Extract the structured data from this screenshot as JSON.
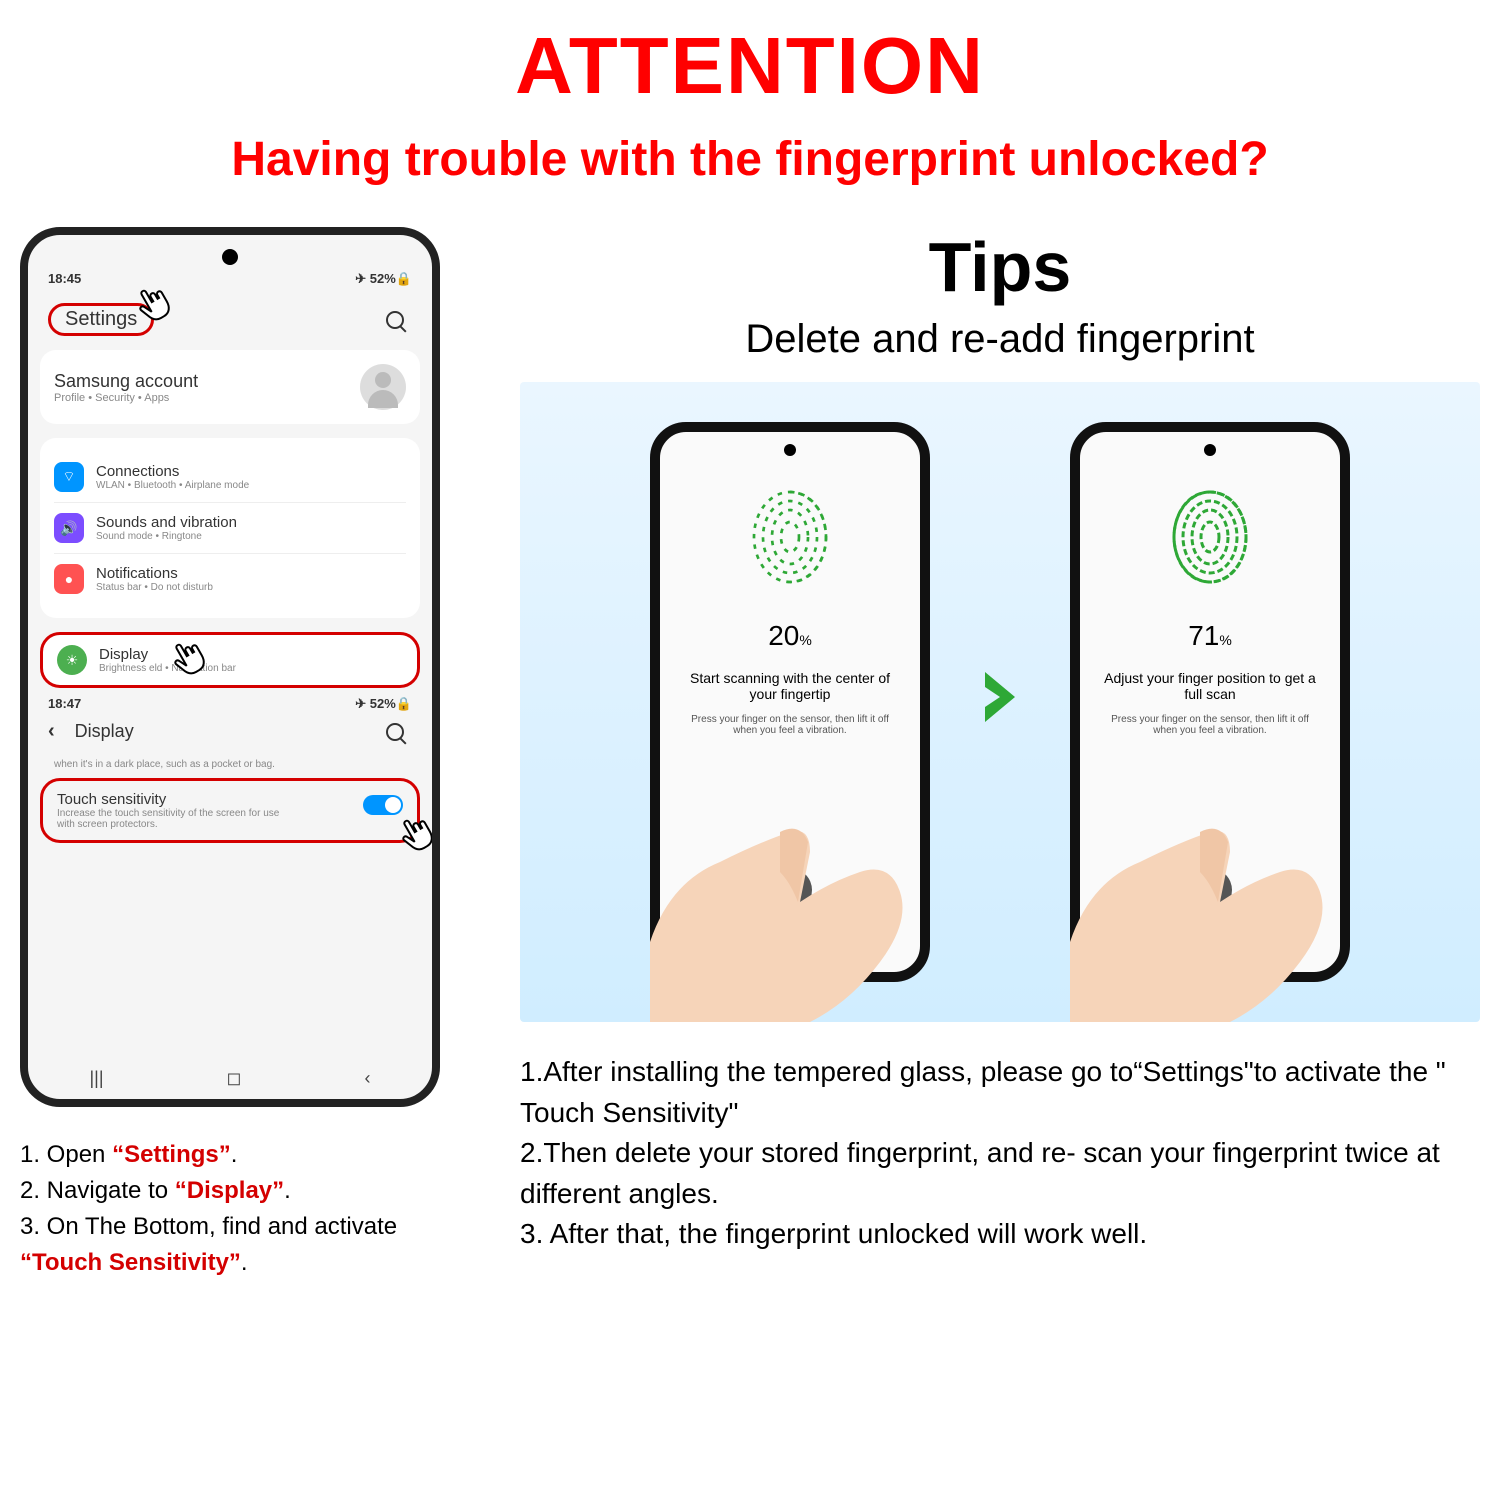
{
  "header": {
    "attention": "ATTENTION",
    "subtitle": "Having trouble with the fingerprint unlocked?"
  },
  "phone": {
    "status": {
      "time": "18:45",
      "right": "✈ 52%🔒"
    },
    "settings_label": "Settings",
    "account": {
      "title": "Samsung account",
      "sub": "Profile  •  Security  •  Apps"
    },
    "items": [
      {
        "title": "Connections",
        "sub": "WLAN  •  Bluetooth  •  Airplane mode",
        "color": "ic-blue",
        "glyph": "⌔"
      },
      {
        "title": "Sounds and vibration",
        "sub": "Sound mode  •  Ringtone",
        "color": "ic-purple",
        "glyph": "🔊"
      },
      {
        "title": "Notifications",
        "sub": "Status bar  •  Do not disturb",
        "color": "ic-red",
        "glyph": "●"
      }
    ],
    "display": {
      "title": "Display",
      "sub": "Brightness            eld  •  Navigation bar"
    },
    "status2": {
      "time": "18:47",
      "right": "✈ 52%🔒"
    },
    "display_header": "Display",
    "truncated": "when it's in a dark place, such as a pocket or bag.",
    "touch": {
      "title": "Touch sensitivity",
      "sub": "Increase the touch sensitivity of the screen for use with screen protectors."
    },
    "nav": {
      "left": "|||",
      "mid": "◻",
      "right": "‹"
    }
  },
  "left_steps": [
    {
      "pre": "1. Open ",
      "red": "“Settings”",
      "post": "."
    },
    {
      "pre": "2. Navigate to ",
      "red": "“Display”",
      "post": "."
    },
    {
      "pre": "3. On The Bottom, find and activate ",
      "red": "“Touch Sensitivity”",
      "post": "."
    }
  ],
  "tips": {
    "title": "Tips",
    "subtitle": "Delete and re-add fingerprint",
    "phones": [
      {
        "percent": "20",
        "title": "Start scanning with the center of your fingertip",
        "desc": "Press your finger on the sensor, then lift it off when you feel a vibration."
      },
      {
        "percent": "71",
        "title": "Adjust your finger position to get a full scan",
        "desc": "Press your finger on the sensor, then lift it off when you feel a vibration."
      }
    ]
  },
  "right_steps": [
    "1.After installing the tempered glass, please go to“Settings\"to activate the \" Touch Sensitivity\"",
    "2.Then delete your stored fingerprint, and re- scan your fingerprint twice at different angles.",
    "3. After that, the fingerprint unlocked will work well."
  ]
}
